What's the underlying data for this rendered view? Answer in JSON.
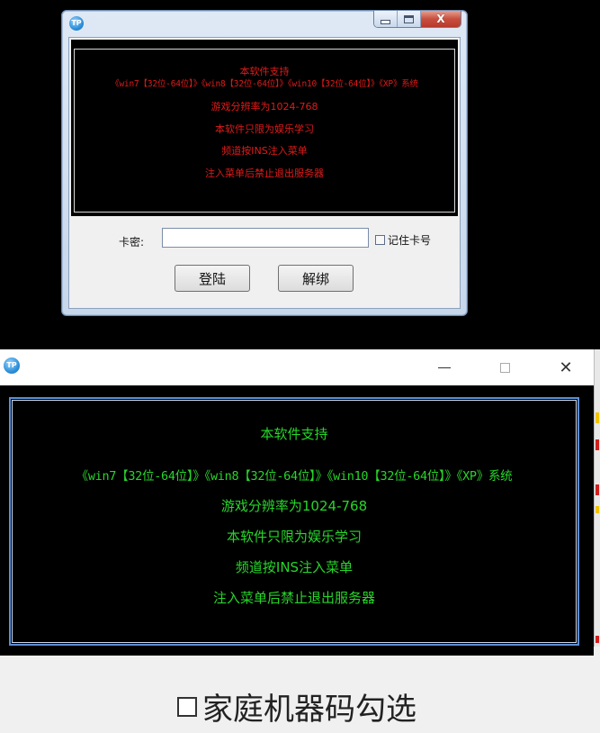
{
  "top_window": {
    "app_icon_text": "TP",
    "caption": {
      "min_icon": "minimize-icon",
      "max_icon": "maximize-icon",
      "close_icon": "close-icon",
      "close_glyph": "X"
    },
    "notice_lines": [
      "本软件支持",
      "《win7【32位-64位】》《win8【32位-64位】》《win10【32位-64位】》《XP》系统",
      "游戏分辨率为1024-768",
      "本软件只限为娱乐学习",
      "频道按INS注入菜单",
      "注入菜单后禁止退出服务器"
    ],
    "card_label": "卡密:",
    "card_value": "",
    "remember_label": "记住卡号",
    "login_button": "登陆",
    "unbind_button": "解绑",
    "text_color": "#e11b1b"
  },
  "bottom_window": {
    "app_icon_text": "TP",
    "caption": {
      "min_icon": "minimize-icon",
      "max_icon": "maximize-icon",
      "close_icon": "close-icon",
      "close_glyph": "✕"
    },
    "notice_lines": [
      "本软件支持",
      "《win7【32位-64位】》《win8【32位-64位】》《win10【32位-64位】》《XP》系统",
      "游戏分辨率为1024-768",
      "本软件只限为娱乐学习",
      "频道按INS注入菜单",
      "注入菜单后禁止退出服务器"
    ],
    "family_checkbox_label": "家庭机器码勾选",
    "text_color": "#27d62a",
    "frame_color": "#5b8fd6"
  }
}
